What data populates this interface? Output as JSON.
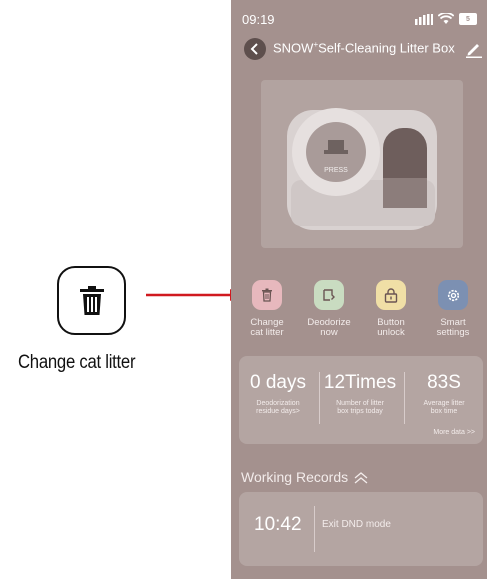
{
  "annotation": {
    "label": "Change cat litter",
    "icon": "trash-icon",
    "arrow_color": "#d0191f"
  },
  "status_bar": {
    "time": "09:19",
    "battery": "5"
  },
  "header": {
    "title_main": "SNOW",
    "title_sup": "+",
    "title_rest": "Self-Cleaning Litter Box"
  },
  "hero": {
    "button_label": "PRESS"
  },
  "actions": [
    {
      "line1": "Change",
      "line2": "cat litter",
      "icon": "trash-icon",
      "color": "#e7b8bd"
    },
    {
      "line1": "Deodorize",
      "line2": "now",
      "icon": "deodorize-icon",
      "color": "#c9dcc1"
    },
    {
      "line1": "Button",
      "line2": "unlock",
      "icon": "lock-icon",
      "color": "#f0dfa6"
    },
    {
      "line1": "Smart",
      "line2": "settings",
      "icon": "gear-icon",
      "color": "#7c90b2"
    }
  ],
  "stats": {
    "items": [
      {
        "value": "0 days",
        "line1": "Deodorization",
        "line2": "residue days>"
      },
      {
        "value": "12Times",
        "line1": "Number of litter",
        "line2": "box trips today"
      },
      {
        "value": "83S",
        "line1": "Average litter",
        "line2": "box time"
      }
    ],
    "more_label": "More data >>"
  },
  "records": {
    "title": "Working Records",
    "items": [
      {
        "time": "10:42",
        "event": "Exit DND mode"
      }
    ]
  }
}
